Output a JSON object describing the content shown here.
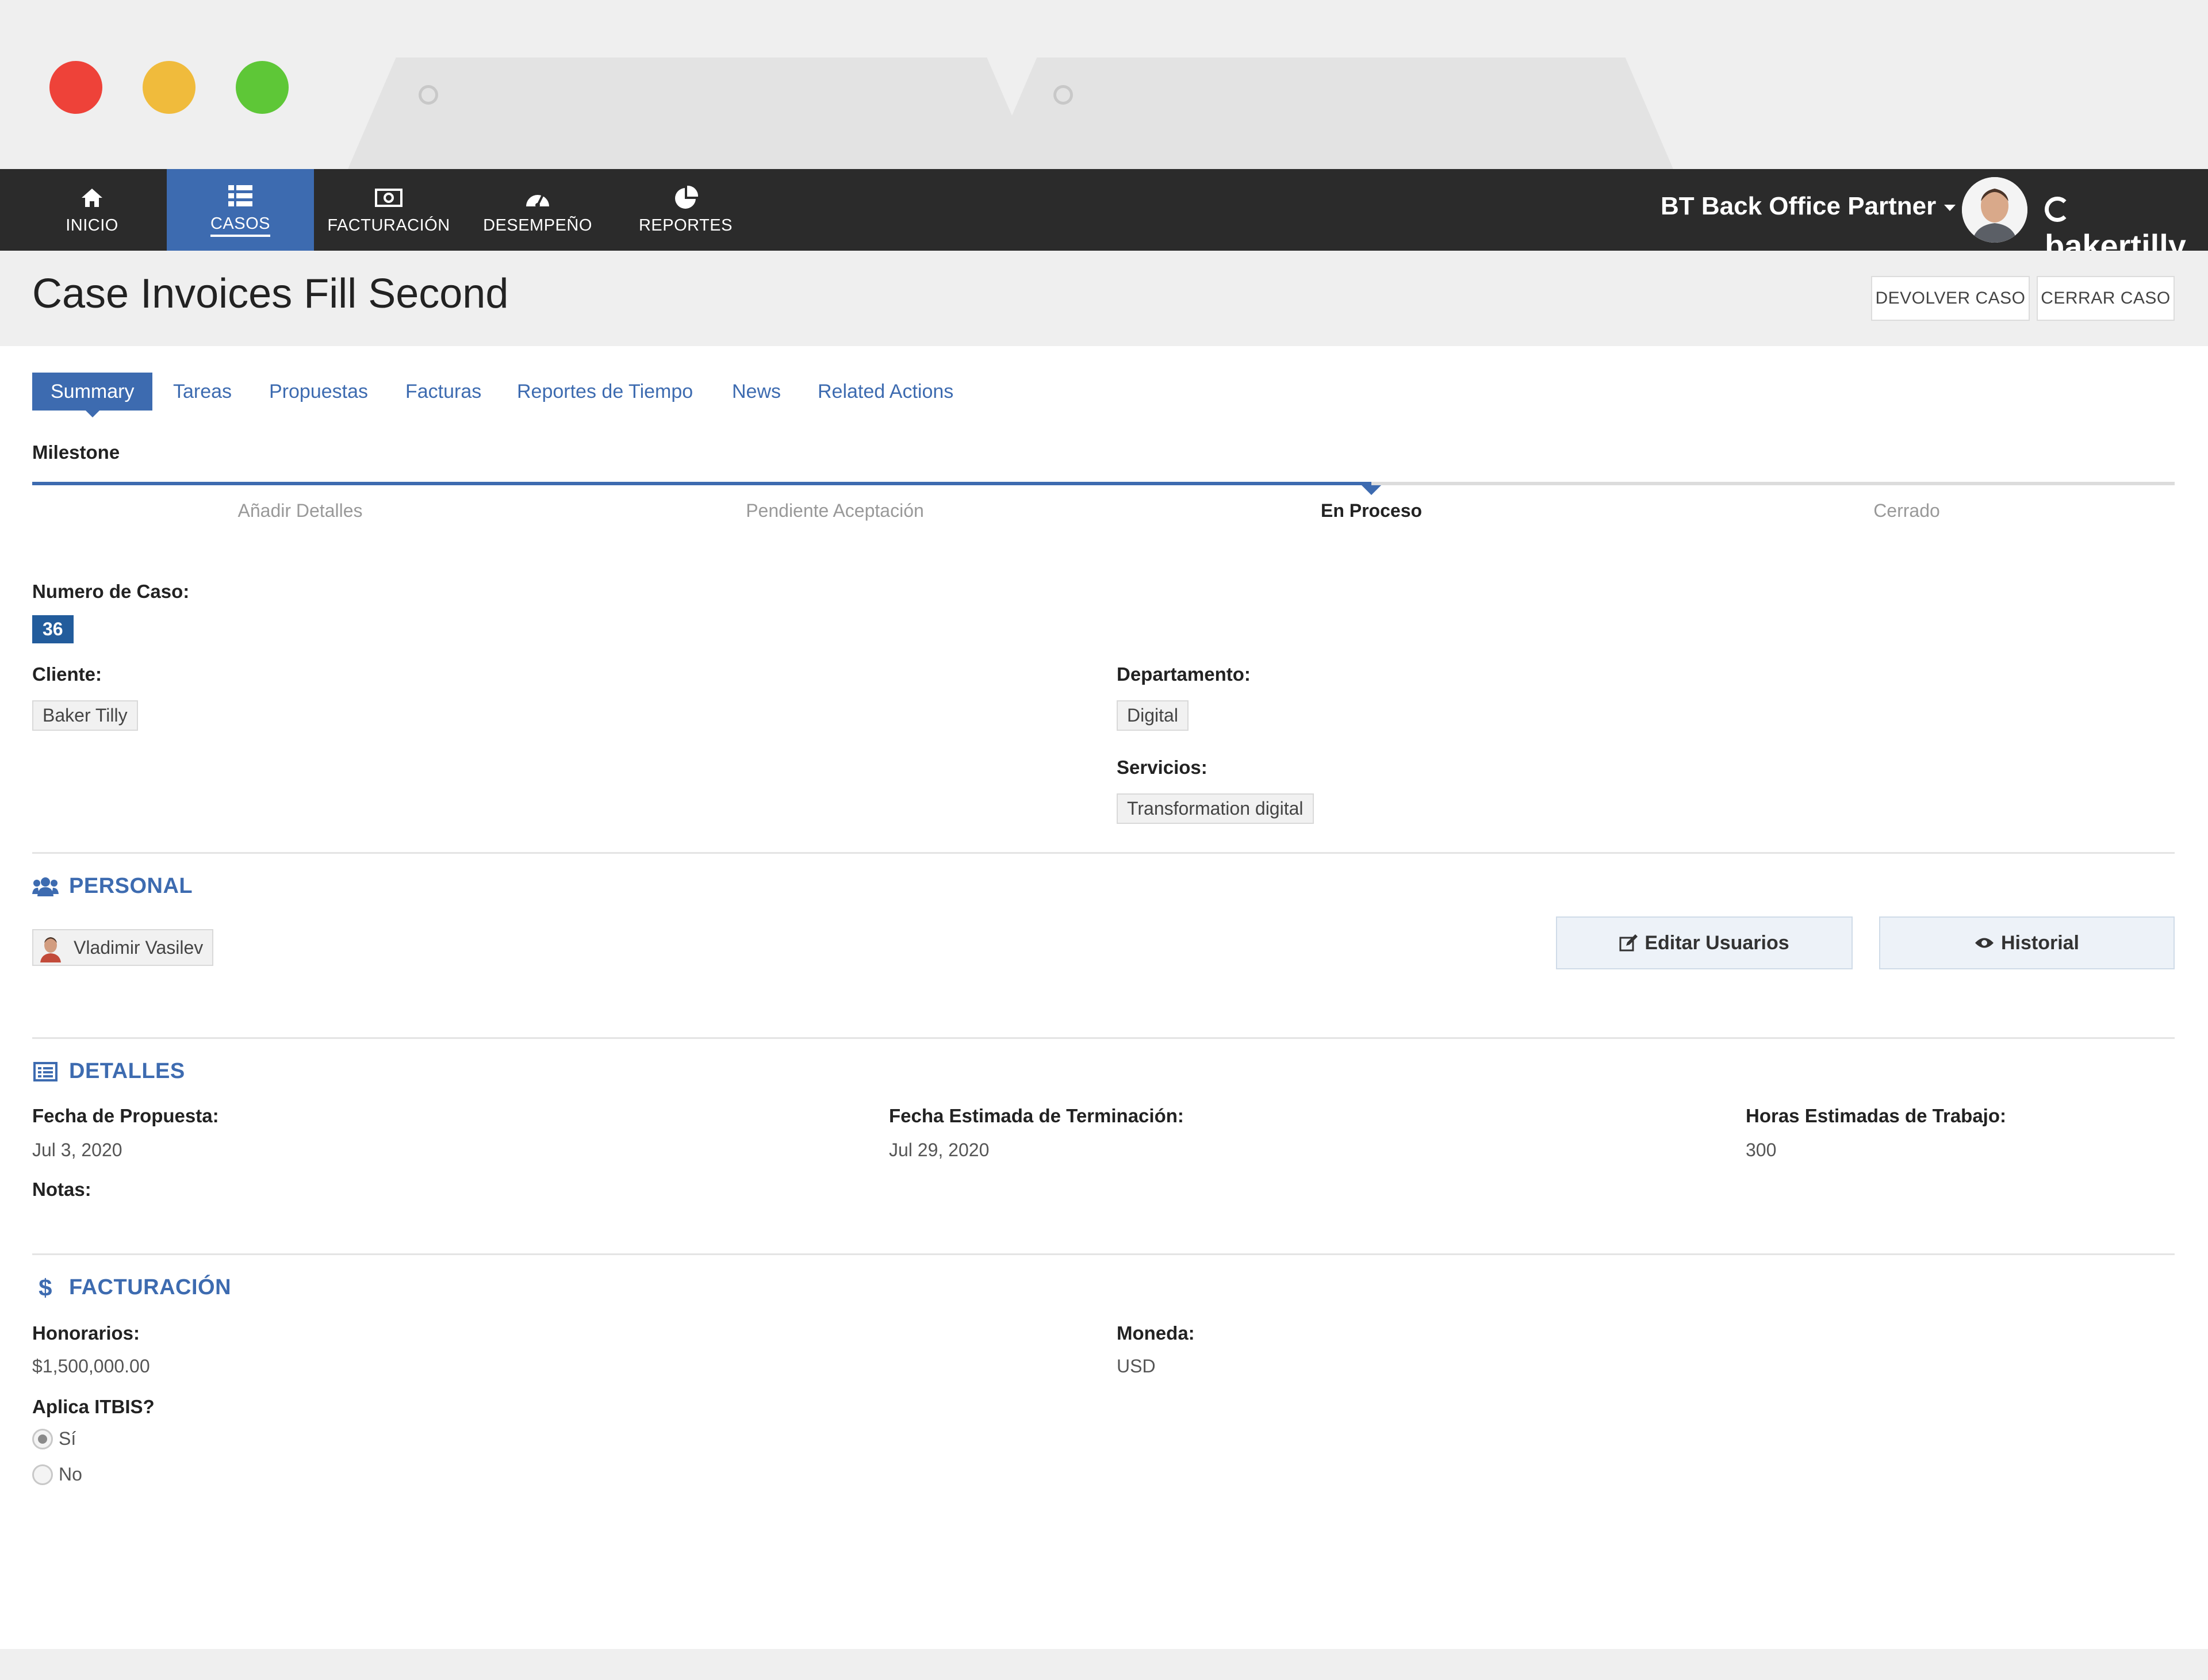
{
  "nav": {
    "items": [
      {
        "label": "INICIO",
        "icon": "home-icon"
      },
      {
        "label": "CASOS",
        "icon": "list-icon"
      },
      {
        "label": "FACTURACIÓN",
        "icon": "money-icon"
      },
      {
        "label": "DESEMPEÑO",
        "icon": "dashboard-icon"
      },
      {
        "label": "REPORTES",
        "icon": "pie-chart-icon"
      }
    ],
    "active": "CASOS",
    "partner": "BT Back Office Partner",
    "brand": "bakertilly"
  },
  "header": {
    "title": "Case Invoices Fill Second",
    "actions": [
      "DEVOLVER CASO",
      "CERRAR CASO"
    ]
  },
  "tabs": [
    "Summary",
    "Tareas",
    "Propuestas",
    "Facturas",
    "Reportes de Tiempo",
    "News",
    "Related Actions"
  ],
  "milestone": {
    "label": "Milestone",
    "steps": [
      "Añadir Detalles",
      "Pendiente Aceptación",
      "En Proceso",
      "Cerrado"
    ],
    "current_index": 2,
    "progress": 0.625
  },
  "case": {
    "number_label": "Numero de Caso:",
    "number": "36",
    "client_label": "Cliente:",
    "client": "Baker Tilly",
    "department_label": "Departamento:",
    "department": "Digital",
    "services_label": "Servicios:",
    "services": "Transformation digital"
  },
  "personal": {
    "heading": "PERSONAL",
    "user": "Vladimir Vasilev",
    "edit_button": "Editar Usuarios",
    "history_button": "Historial"
  },
  "detalles": {
    "heading": "DETALLES",
    "proposal_date_label": "Fecha de Propuesta:",
    "proposal_date": "Jul 3, 2020",
    "end_date_label": "Fecha Estimada de Terminación:",
    "end_date": "Jul 29, 2020",
    "hours_label": "Horas Estimadas de Trabajo:",
    "hours": "300",
    "notes_label": "Notas:"
  },
  "facturacion": {
    "heading": "FACTURACIÓN",
    "fees_label": "Honorarios:",
    "fees": "$1,500,000.00",
    "currency_label": "Moneda:",
    "currency": "USD",
    "itbis_label": "Aplica ITBIS?",
    "options": [
      "Sí",
      "No"
    ],
    "selected": "Sí"
  },
  "colors": {
    "accent": "#3d6bb0",
    "nav_bg": "#2b2b2b",
    "badge": "#225c9c"
  }
}
